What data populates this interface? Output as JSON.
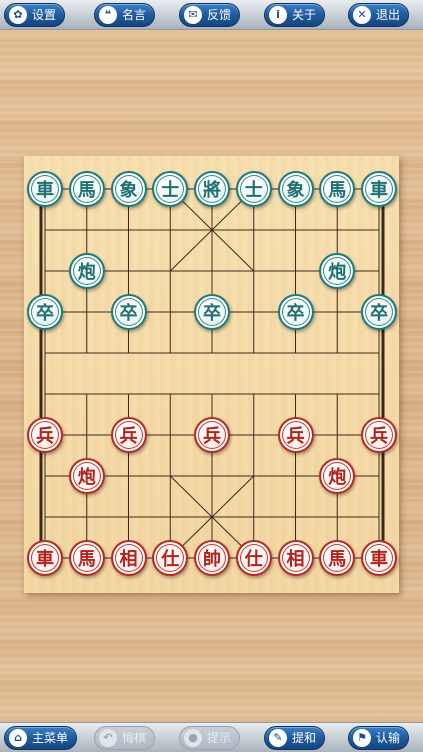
{
  "top_bar": {
    "settings": {
      "label": "设置",
      "icon": "gear-icon",
      "glyph": "✿"
    },
    "quotes": {
      "label": "名言",
      "icon": "speech-bubble-icon",
      "glyph": "❝"
    },
    "feedback": {
      "label": "反馈",
      "icon": "envelope-icon",
      "glyph": "✉"
    },
    "about": {
      "label": "关于",
      "icon": "info-icon",
      "glyph": "i"
    },
    "exit": {
      "label": "退出",
      "icon": "close-icon",
      "glyph": "✕"
    }
  },
  "bottom_bar": {
    "main_menu": {
      "label": "主菜单",
      "icon": "home-icon",
      "glyph": "⌂"
    },
    "undo": {
      "label": "悔棋",
      "icon": "undo-icon",
      "glyph": "↶",
      "disabled": true
    },
    "hint": {
      "label": "提示",
      "icon": "lightbulb-icon",
      "glyph": "●",
      "disabled": true
    },
    "offer_draw": {
      "label": "提和",
      "icon": "pencil-icon",
      "glyph": "✎"
    },
    "resign": {
      "label": "认输",
      "icon": "flag-icon",
      "glyph": "⚑"
    }
  },
  "colors": {
    "black_side": "#1d706f",
    "red_side": "#b3231b",
    "board": "#f5daa6",
    "button": "#1f5aa0"
  },
  "pieces": {
    "black": [
      {
        "char": "車",
        "col": 0,
        "row": 0
      },
      {
        "char": "馬",
        "col": 1,
        "row": 0
      },
      {
        "char": "象",
        "col": 2,
        "row": 0
      },
      {
        "char": "士",
        "col": 3,
        "row": 0
      },
      {
        "char": "將",
        "col": 4,
        "row": 0
      },
      {
        "char": "士",
        "col": 5,
        "row": 0
      },
      {
        "char": "象",
        "col": 6,
        "row": 0
      },
      {
        "char": "馬",
        "col": 7,
        "row": 0
      },
      {
        "char": "車",
        "col": 8,
        "row": 0
      },
      {
        "char": "炮",
        "col": 1,
        "row": 2
      },
      {
        "char": "炮",
        "col": 7,
        "row": 2
      },
      {
        "char": "卒",
        "col": 0,
        "row": 3
      },
      {
        "char": "卒",
        "col": 2,
        "row": 3
      },
      {
        "char": "卒",
        "col": 4,
        "row": 3
      },
      {
        "char": "卒",
        "col": 6,
        "row": 3
      },
      {
        "char": "卒",
        "col": 8,
        "row": 3
      }
    ],
    "red": [
      {
        "char": "兵",
        "col": 0,
        "row": 6
      },
      {
        "char": "兵",
        "col": 2,
        "row": 6
      },
      {
        "char": "兵",
        "col": 4,
        "row": 6
      },
      {
        "char": "兵",
        "col": 6,
        "row": 6
      },
      {
        "char": "兵",
        "col": 8,
        "row": 6
      },
      {
        "char": "炮",
        "col": 1,
        "row": 7
      },
      {
        "char": "炮",
        "col": 7,
        "row": 7
      },
      {
        "char": "車",
        "col": 0,
        "row": 9
      },
      {
        "char": "馬",
        "col": 1,
        "row": 9
      },
      {
        "char": "相",
        "col": 2,
        "row": 9
      },
      {
        "char": "仕",
        "col": 3,
        "row": 9
      },
      {
        "char": "帥",
        "col": 4,
        "row": 9
      },
      {
        "char": "仕",
        "col": 5,
        "row": 9
      },
      {
        "char": "相",
        "col": 6,
        "row": 9
      },
      {
        "char": "馬",
        "col": 7,
        "row": 9
      },
      {
        "char": "車",
        "col": 8,
        "row": 9
      }
    ]
  }
}
